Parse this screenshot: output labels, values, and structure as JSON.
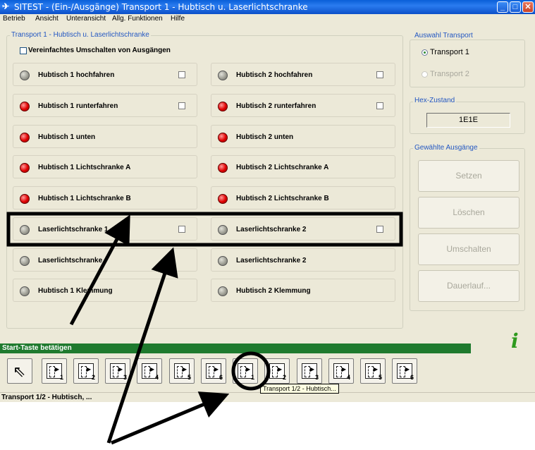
{
  "window": {
    "title": "SITEST - (Ein-/Ausgänge) Transport 1 - Hubtisch u. Laserlichtschranke",
    "min": "_",
    "max": "□",
    "close": "✕"
  },
  "menu": [
    "Betrieb",
    "Ansicht",
    "Unteransicht",
    "Allg. Funktionen",
    "Hilfe"
  ],
  "main_group": {
    "title": "Transport 1 - Hubtisch u. Laserlichtschranke",
    "simplify_label": "Vereinfachtes Umschalten von Ausgängen",
    "left": [
      {
        "label": "Hubtisch 1 hochfahren",
        "led": "gray",
        "checkbox": true
      },
      {
        "label": "Hubtisch 1 runterfahren",
        "led": "red",
        "checkbox": true
      },
      {
        "label": "Hubtisch 1 unten",
        "led": "red",
        "checkbox": false
      },
      {
        "label": "Hubtisch 1 Lichtschranke A",
        "led": "red",
        "checkbox": false
      },
      {
        "label": "Hubtisch 1 Lichtschranke B",
        "led": "red",
        "checkbox": false
      },
      {
        "label": "Laserlichtschranke 1",
        "led": "gray",
        "checkbox": true
      },
      {
        "label": "Laserlichtschranke",
        "led": "gray",
        "checkbox": false
      },
      {
        "label": "Hubtisch 1 Klemmung",
        "led": "gray",
        "checkbox": false
      }
    ],
    "right": [
      {
        "label": "Hubtisch 2 hochfahren",
        "led": "gray",
        "checkbox": true
      },
      {
        "label": "Hubtisch 2 runterfahren",
        "led": "red",
        "checkbox": true
      },
      {
        "label": "Hubtisch 2 unten",
        "led": "red",
        "checkbox": false
      },
      {
        "label": "Hubtisch 2 Lichtschranke A",
        "led": "red",
        "checkbox": false
      },
      {
        "label": "Hubtisch 2 Lichtschranke B",
        "led": "red",
        "checkbox": false
      },
      {
        "label": "Laserlichtschranke 2",
        "led": "gray",
        "checkbox": true
      },
      {
        "label": "Laserlichtschranke 2",
        "led": "gray",
        "checkbox": false
      },
      {
        "label": "Hubtisch 2 Klemmung",
        "led": "gray",
        "checkbox": false
      }
    ]
  },
  "transport_group": {
    "title": "Auswahl Transport",
    "opt1": "Transport 1",
    "opt2": "Transport 2"
  },
  "hex_group": {
    "title": "Hex-Zustand",
    "value": "1E1E"
  },
  "outputs_group": {
    "title": "Gewählte Ausgänge",
    "setzen": "Setzen",
    "loeschen": "Löschen",
    "umschalten": "Umschalten",
    "dauerlauf": "Dauerlauf..."
  },
  "status_line": "Start-Taste betätigen",
  "toolbar": {
    "tools": [
      "1",
      "2",
      "3",
      "4",
      "5",
      "6",
      "1",
      "2",
      "3",
      "4",
      "5",
      "6"
    ]
  },
  "tooltip": "Transport 1/2 - Hubtisch...",
  "statusbar": "Transport 1/2 - Hubtisch, ...",
  "colors": {
    "title_blue": "#0a5fd8",
    "status_green": "#1f7a2e",
    "group_title_blue": "#2357c2",
    "led_red": "#e00000"
  }
}
